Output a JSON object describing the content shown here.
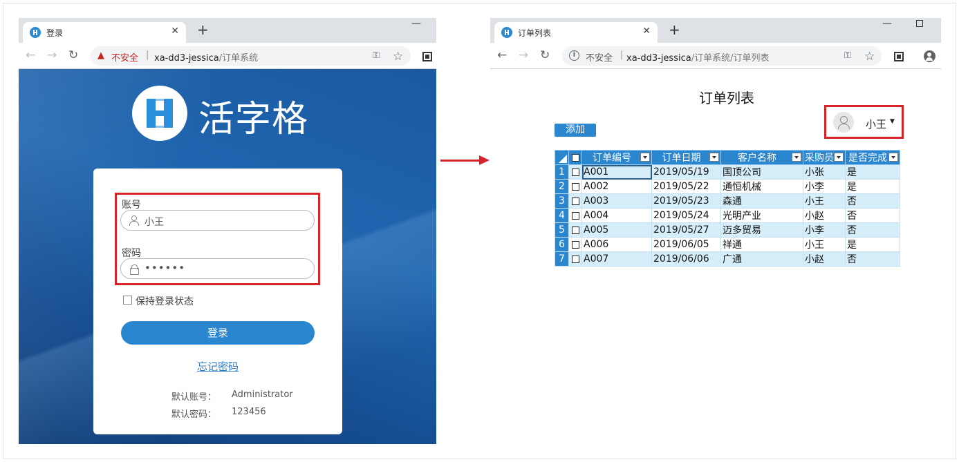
{
  "left_window": {
    "tab": {
      "title": "登录",
      "close": "✕"
    },
    "new_tab": "+",
    "window_minimize": "—",
    "address": {
      "security": "不安全",
      "separator": "|",
      "host": "xa-dd3-jessica",
      "path": "/订单系统"
    },
    "page": {
      "logo_text": "活字格",
      "account_label": "账号",
      "account_value": "小王",
      "password_label": "密码",
      "password_value": "••••••",
      "remember_label": "保持登录状态",
      "login_button": "登录",
      "forgot_link": "忘记密码",
      "default_account_label": "默认账号：",
      "default_account_value": "Administrator",
      "default_password_label": "默认密码：",
      "default_password_value": "123456"
    }
  },
  "right_window": {
    "tab": {
      "title": "订单列表",
      "close": "✕"
    },
    "new_tab": "+",
    "window_minimize": "—",
    "address": {
      "security": "不安全",
      "separator": "|",
      "host": "xa-dd3-jessica",
      "path": "/订单系统/订单列表"
    },
    "page": {
      "title": "订单列表",
      "add_button": "添加",
      "user_name": "小王",
      "user_caret": "▼",
      "table": {
        "columns": [
          "订单编号",
          "订单日期",
          "客户名称",
          "采购员",
          "是否完成"
        ],
        "rows": [
          {
            "n": "1",
            "id": "A001",
            "date": "2019/05/19",
            "customer": "国顶公司",
            "buyer": "小张",
            "done": "是"
          },
          {
            "n": "2",
            "id": "A002",
            "date": "2019/05/22",
            "customer": "通恒机械",
            "buyer": "小李",
            "done": "是"
          },
          {
            "n": "3",
            "id": "A003",
            "date": "2019/05/23",
            "customer": "森通",
            "buyer": "小王",
            "done": "否"
          },
          {
            "n": "4",
            "id": "A004",
            "date": "2019/05/24",
            "customer": "光明产业",
            "buyer": "小赵",
            "done": "否"
          },
          {
            "n": "5",
            "id": "A005",
            "date": "2019/05/27",
            "customer": "迈多贸易",
            "buyer": "小李",
            "done": "否"
          },
          {
            "n": "6",
            "id": "A006",
            "date": "2019/06/05",
            "customer": "祥通",
            "buyer": "小王",
            "done": "是"
          },
          {
            "n": "7",
            "id": "A007",
            "date": "2019/06/06",
            "customer": "广通",
            "buyer": "小赵",
            "done": "否"
          }
        ]
      }
    }
  },
  "colors": {
    "accent": "#2b86d0",
    "highlight": "#d9222a",
    "row_alt": "#d5eefa"
  },
  "icons": [
    "favicon-icon",
    "back-icon",
    "forward-icon",
    "reload-icon",
    "warning-icon",
    "info-icon",
    "key-icon",
    "star-icon",
    "extension-icon",
    "profile-icon",
    "user-icon",
    "lock-icon",
    "avatar-icon",
    "caret-down-icon",
    "filter-icon",
    "arrow-icon"
  ]
}
